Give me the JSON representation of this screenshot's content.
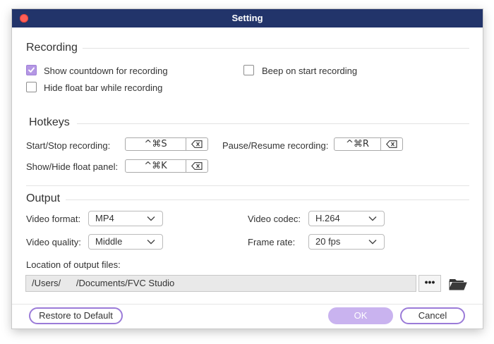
{
  "window": {
    "title": "Setting"
  },
  "recording": {
    "title": "Recording",
    "options": [
      {
        "label": "Show countdown for recording",
        "checked": true
      },
      {
        "label": "Beep on start recording",
        "checked": false
      },
      {
        "label": "Hide float bar while recording",
        "checked": false
      }
    ]
  },
  "hotkeys": {
    "title": "Hotkeys",
    "start_stop": {
      "label": "Start/Stop recording:",
      "keys": "^⌘S"
    },
    "pause_resume": {
      "label": "Pause/Resume recording:",
      "keys": "^⌘R"
    },
    "show_hide": {
      "label": "Show/Hide float panel:",
      "keys": "^⌘K"
    }
  },
  "output": {
    "title": "Output",
    "video_format": {
      "label": "Video format:",
      "value": "MP4"
    },
    "video_codec": {
      "label": "Video codec:",
      "value": "H.264"
    },
    "video_quality": {
      "label": "Video quality:",
      "value": "Middle"
    },
    "frame_rate": {
      "label": "Frame rate:",
      "value": "20 fps"
    },
    "location": {
      "label": "Location of output files:",
      "path": "/Users/      /Documents/FVC Studio",
      "more_label": "•••"
    }
  },
  "footer": {
    "restore_label": "Restore to Default",
    "ok_label": "OK",
    "cancel_label": "Cancel"
  },
  "colors": {
    "titlebar": "#22346a",
    "accent": "#9b7bd8",
    "ok_fill": "#c9b3ef",
    "checkbox_checked": "#b497e4"
  },
  "icons": {
    "close": "close-dot-icon",
    "check": "checkmark-icon",
    "backspace": "backspace-icon",
    "chevron": "chevron-down-icon",
    "folder": "folder-icon"
  }
}
